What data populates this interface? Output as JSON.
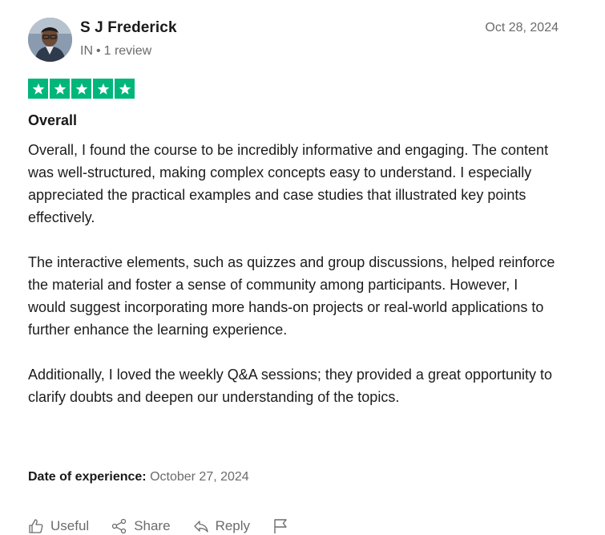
{
  "reviewer": {
    "name": "S J Frederick",
    "country": "IN",
    "separator": "•",
    "review_count": "1 review"
  },
  "review": {
    "date": "Oct 28, 2024",
    "rating": 5,
    "rating_max": 5,
    "star_color": "#00b67a",
    "title": "Overall",
    "paragraphs": [
      "Overall, I found the course to be incredibly informative and engaging. The content was well-structured, making complex concepts easy to understand. I especially appreciated the practical examples and case studies that illustrated key points effectively.",
      "The interactive elements, such as quizzes and group discussions, helped reinforce the material and foster a sense of community among participants. However, I would suggest incorporating more hands-on projects or real-world applications to further enhance the learning experience.",
      "Additionally, I loved the weekly Q&A sessions; they provided a great opportunity to clarify doubts and deepen our understanding of the topics."
    ],
    "experience_label": "Date of experience:",
    "experience_date": "October 27, 2024"
  },
  "actions": {
    "useful_label": "Useful",
    "useful_icon": "thumbs-up-icon",
    "share_label": "Share",
    "share_icon": "share-icon",
    "reply_label": "Reply",
    "reply_icon": "reply-icon",
    "flag_icon": "flag-icon"
  }
}
